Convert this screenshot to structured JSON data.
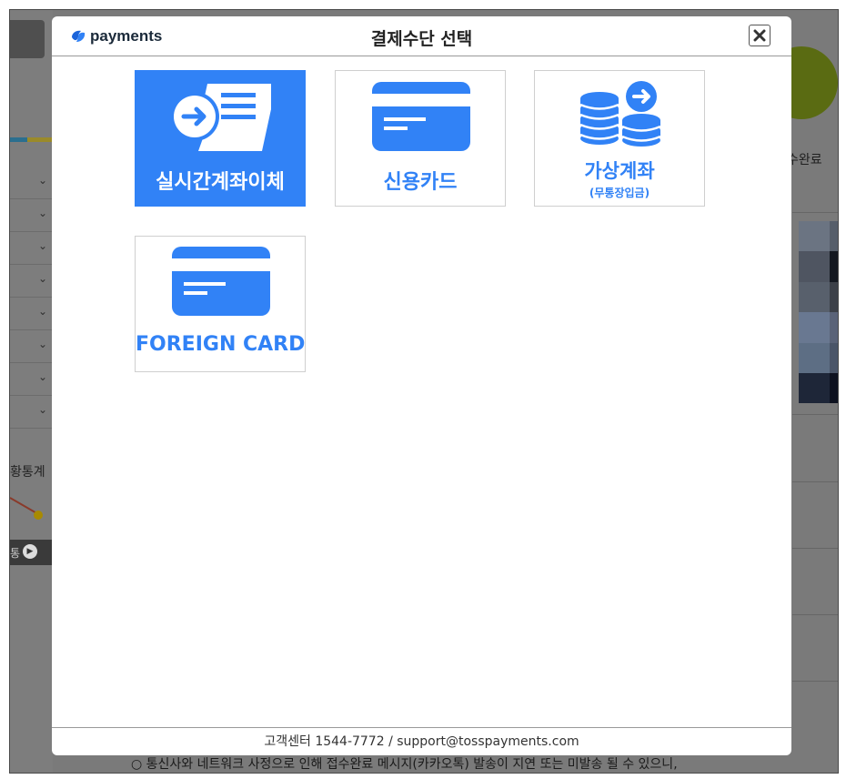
{
  "background": {
    "left_stats_label": "황통계",
    "left_bottom_label": "통",
    "right_status_label": "수완료",
    "bottom_notice": "○ 통신사와 네트워크 사정으로 인해 접수완료 메시지(카카오톡) 발송이 지연 또는 미발송 될 수 있으니,"
  },
  "modal": {
    "logo_text": "payments",
    "title": "결제수단 선택",
    "close_icon": "close-icon",
    "methods": [
      {
        "label": "실시간계좌이체",
        "icon": "bank-transfer-icon",
        "selected": true
      },
      {
        "label": "신용카드",
        "icon": "credit-card-icon",
        "selected": false
      },
      {
        "label": "가상계좌",
        "sub": "(무통장입금)",
        "icon": "coins-arrow-icon",
        "selected": false
      },
      {
        "label": "FOREIGN CARD",
        "icon": "credit-card-icon",
        "selected": false
      }
    ],
    "footer": "고객센터 1544-7772 / support@tosspayments.com"
  },
  "colors": {
    "accent": "#3182f6",
    "overlay": "#7a7a7a",
    "text": "#222222"
  }
}
